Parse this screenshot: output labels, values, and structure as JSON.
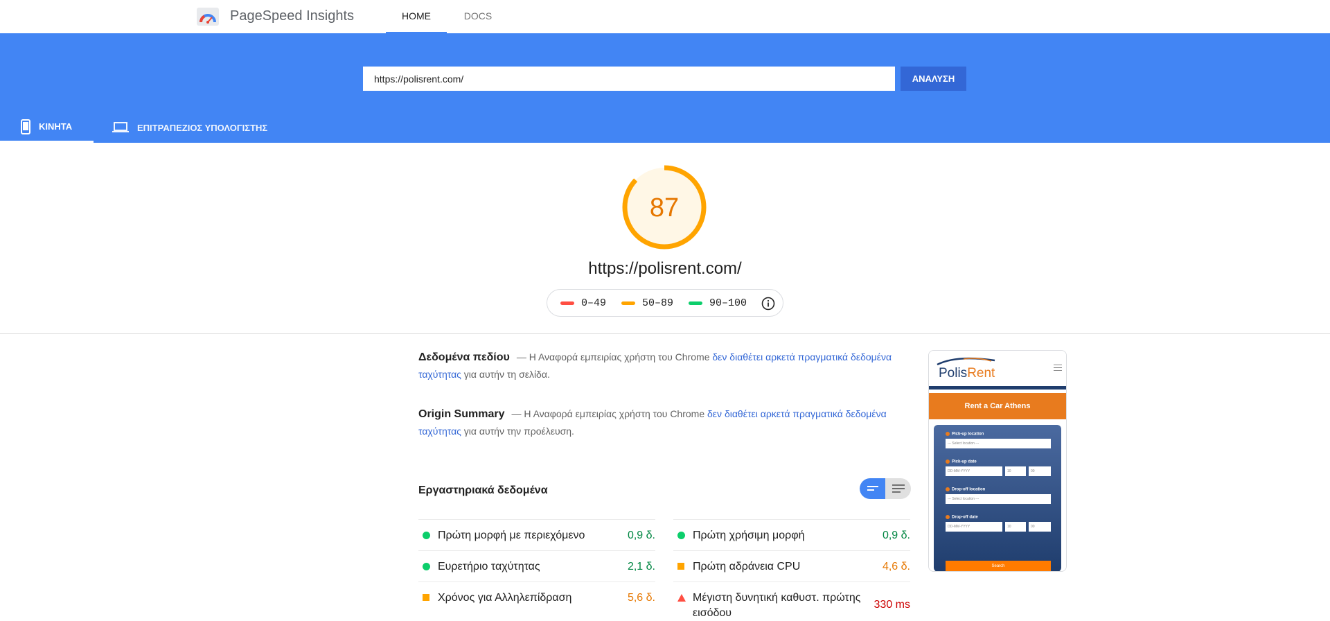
{
  "app": {
    "title": "PageSpeed Insights",
    "logo_icon": "pagespeed-gauge-icon"
  },
  "nav": {
    "home_label": "HOME",
    "docs_label": "DOCS"
  },
  "search": {
    "url_value": "https://polisrent.com/",
    "analyze_label": "ΑΝΑΛΥΣΗ"
  },
  "device_tabs": {
    "mobile_label": "ΚΙΝΗΤΑ",
    "desktop_label": "ΕΠΙΤΡΑΠΕΖΙΟΣ ΥΠΟΛΟΓΙΣΤΗΣ",
    "active": "mobile"
  },
  "score": {
    "value": "87",
    "fraction": 0.87,
    "color": "#ffa400",
    "url": "https://polisrent.com/"
  },
  "legend": [
    {
      "range": "0–49",
      "color": "#ff4e42"
    },
    {
      "range": "50–89",
      "color": "#ffa400"
    },
    {
      "range": "90–100",
      "color": "#0cce6b"
    }
  ],
  "field_data": {
    "title": "Δεδομένα πεδίου",
    "text_before": "— Η Αναφορά εμπειρίας χρήστη του Chrome ",
    "link": "δεν διαθέτει αρκετά πραγματικά δεδομένα ταχύτητας",
    "text_after": " για αυτήν τη σελίδα."
  },
  "origin_summary": {
    "title": "Origin Summary",
    "text_before": "— Η Αναφορά εμπειρίας χρήστη του Chrome ",
    "link": "δεν διαθέτει αρκετά πραγματικά δεδομένα ταχύτητας",
    "text_after": " για αυτήν την προέλευση."
  },
  "lab": {
    "title": "Εργαστηριακά δεδομένα",
    "left": [
      {
        "name": "Πρώτη μορφή με περιεχόμενο",
        "value": "0,9 δ.",
        "status": "pass",
        "color": "#018642"
      },
      {
        "name": "Ευρετήριο ταχύτητας",
        "value": "2,1 δ.",
        "status": "pass",
        "color": "#018642"
      },
      {
        "name": "Χρόνος για Αλληλεπίδραση",
        "value": "5,6 δ.",
        "status": "average",
        "color": "#e67700"
      }
    ],
    "right": [
      {
        "name": "Πρώτη χρήσιμη μορφή",
        "value": "0,9 δ.",
        "status": "pass",
        "color": "#018642"
      },
      {
        "name": "Πρώτη αδράνεια CPU",
        "value": "4,6 δ.",
        "status": "average",
        "color": "#e67700"
      },
      {
        "name": "Μέγιστη δυνητική καθυστ. πρώτης εισόδου",
        "value": "330 ms",
        "status": "fail",
        "color": "#cc0000"
      }
    ]
  },
  "screenshot": {
    "logo_left": "Polis",
    "logo_right": "Rent",
    "banner": "Rent a Car Athens",
    "pickup_location_label": "Pick-up location",
    "pickup_location_value": "--- Select location ---",
    "pickup_date_label": "Pick-up date",
    "pickup_date_value": "DD-MM-YYYY",
    "pickup_hour": "10",
    "pickup_min": "00",
    "dropoff_location_label": "Drop-off location",
    "dropoff_location_value": "--- Select location ---",
    "dropoff_date_label": "Drop-off date",
    "dropoff_date_value": "DD-MM-YYYY",
    "dropoff_hour": "10",
    "dropoff_min": "00",
    "search_label": "Search"
  }
}
